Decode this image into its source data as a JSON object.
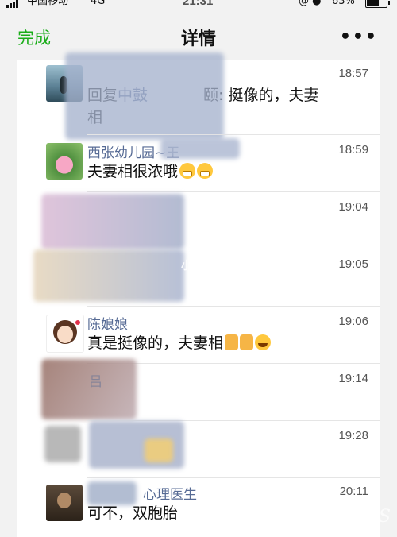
{
  "status_bar": {
    "carrier": "中国移动",
    "network": "4G",
    "time": "21:31",
    "battery_percent": "63%",
    "battery_level": 0.63
  },
  "nav": {
    "done_label": "完成",
    "title": "详情",
    "more_icon": "more-dots-icon"
  },
  "comments": [
    {
      "name": "",
      "time": "18:57",
      "text_prefix": "回复",
      "text_visible_a": "中鼓",
      "text_visible_b": "颐: 挺像的，夫妻",
      "text_line2": "相",
      "avatar": "silhouette-avatar"
    },
    {
      "name": "西张幼儿园~王",
      "time": "18:59",
      "text": "夫妻相很浓哦",
      "emojis": [
        "grin",
        "grin"
      ],
      "avatar": "lotus-avatar"
    },
    {
      "name": "",
      "time": "19:04",
      "text": "",
      "avatar": "blurred-avatar"
    },
    {
      "name": "",
      "time": "19:05",
      "text": "",
      "avatar": "blurred-avatar"
    },
    {
      "name": "陈娘娘",
      "time": "19:06",
      "text": "真是挺像的，夫妻相",
      "emojis": [
        "thumbs-up",
        "thumbs-up",
        "joy"
      ],
      "avatar": "cartoon-girl-avatar"
    },
    {
      "name": "吕",
      "time": "19:14",
      "text": "",
      "avatar": "blurred-avatar"
    },
    {
      "name": "",
      "time": "19:28",
      "text": "",
      "avatar": "blurred-avatar"
    },
    {
      "name": "心理医生",
      "time": "20:11",
      "text": "可不，双胞胎",
      "avatar": "portrait-avatar"
    }
  ],
  "watermark": "小红书",
  "corner_mark": "H..S"
}
